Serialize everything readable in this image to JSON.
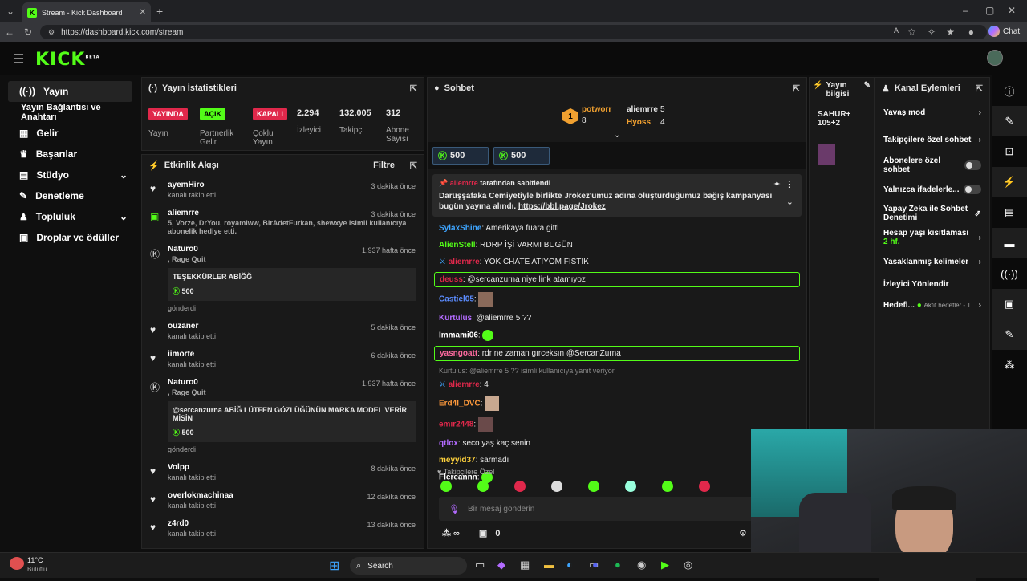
{
  "browser": {
    "tab_title": "Stream - Kick Dashboard",
    "url": "https://dashboard.kick.com/stream",
    "chat_label": "Chat"
  },
  "header": {
    "logo": "KICK",
    "logo_sup": "BETA"
  },
  "sidebar": {
    "items": [
      {
        "label": "Yayın",
        "icon": "broadcast-icon"
      },
      {
        "label": "Yayın Bağlantısı ve Anahtarı",
        "icon": ""
      },
      {
        "label": "Gelir",
        "icon": "chart-icon"
      },
      {
        "label": "Başarılar",
        "icon": "trophy-icon"
      },
      {
        "label": "Stüdyo",
        "icon": "grid-icon"
      },
      {
        "label": "Denetleme",
        "icon": "wrench-icon"
      },
      {
        "label": "Topluluk",
        "icon": "people-icon"
      },
      {
        "label": "Droplar ve ödüller",
        "icon": "gift-icon"
      }
    ]
  },
  "stats": {
    "title": "Yayın İstatistikleri",
    "yayin_badge": "YAYINDA",
    "yayin_label": "Yayın",
    "partner_badge": "AÇIK",
    "partner_label": "Partnerlik Gelir",
    "mode_badge": "KAPALI",
    "mode_label": "Çoklu Yayın",
    "viewers": "2.294",
    "viewers_label": "İzleyici",
    "followers": "132.005",
    "followers_label": "Takipçi",
    "subs": "312",
    "subs_label": "Abone Sayısı"
  },
  "activity": {
    "title": "Etkinlik Akışı",
    "filter": "Filtre",
    "items": [
      {
        "name": "ayemHiro",
        "sub": "kanalı takip etti",
        "time": "3 dakika önce",
        "icon": "heart-icon"
      },
      {
        "name": "aliemrre",
        "sub": "5, Vorze, DrYou, royamiww, BirAdetFurkan, shewxye isimli kullanıcıya abonelik hediye etti.",
        "time": "3 dakika önce",
        "icon": "gift-icon"
      },
      {
        "name": "Naturo0",
        "sub": ", Rage Quit",
        "time": "1.937 hafta önce",
        "icon": "kick-icon",
        "msg": "TEŞEKKÜRLER ABİĞĞ",
        "amount": "500",
        "sent": "gönderdi"
      },
      {
        "name": "ouzaner",
        "sub": "kanalı takip etti",
        "time": "5 dakika önce",
        "icon": "heart-icon"
      },
      {
        "name": "iimorte",
        "sub": "kanalı takip etti",
        "time": "6 dakika önce",
        "icon": "heart-icon"
      },
      {
        "name": "Naturo0",
        "sub": ", Rage Quit",
        "time": "1.937 hafta önce",
        "icon": "kick-icon",
        "msg": "@sercanzurna ABİĞ LÜTFEN GÖZLÜĞÜNÜN MARKA MODEL VERİR MİSİN",
        "amount": "500",
        "sent": "gönderdi"
      },
      {
        "name": "Volpp",
        "sub": "kanalı takip etti",
        "time": "8 dakika önce",
        "icon": "heart-icon"
      },
      {
        "name": "overlokmachinaa",
        "sub": "kanalı takip etti",
        "time": "12 dakika önce",
        "icon": "heart-icon"
      },
      {
        "name": "z4rd0",
        "sub": "kanalı takip etti",
        "time": "13 dakika önce",
        "icon": "heart-icon"
      }
    ]
  },
  "chat": {
    "title": "Sohbet",
    "top": [
      {
        "rank": "1",
        "name": "potworr",
        "count": "8"
      },
      {
        "name": "aliemrre",
        "count": "5"
      },
      {
        "name": "Hyoss",
        "count": "4"
      }
    ],
    "pills": [
      "500",
      "500"
    ],
    "pinned_by": "tarafından sabitlendi",
    "pinned_user": "aliemrre",
    "pinned_text": "Darüşşafaka Cemiyetiyle birlikte Jrokez'umuz adına oluşturduğumuz bağış kampanyası bugün yayına alındı.",
    "pinned_link": "https://bbl.page/Jrokez",
    "messages": [
      {
        "user": "SylaxShine",
        "color": "#3ea5ff",
        "text": "Amerikaya fuara gitti"
      },
      {
        "user": "AlienStell",
        "color": "#53fc18",
        "text": "RDRP İŞİ VARMI BUGÜN"
      },
      {
        "user": "aliemrre",
        "color": "#e0284b",
        "text": "YOK CHATE ATIYOM FISTIK"
      },
      {
        "user": "deuss",
        "color": "#e0284b",
        "text": "@sercanzurna niye link atamıyoz",
        "hl": true
      },
      {
        "user": "Castiel05",
        "color": "#5b8cff",
        "text": ""
      },
      {
        "user": "Kurtulus",
        "color": "#b36bff",
        "text": "@aliemrre 5 ??"
      },
      {
        "user": "Immami06",
        "color": "#ffffff",
        "text": ""
      },
      {
        "user": "yasngoatt",
        "color": "#ff6aa0",
        "text": "rdr ne zaman gırceksın @SercanZurna",
        "hl": true
      },
      {
        "user": "aliemrre",
        "color": "#e0284b",
        "text": "4",
        "reply": "Kurtulus: @aliemrre 5 ?? isimli kullanıcıya yanıt veriyor"
      },
      {
        "user": "Erd4l_DVC",
        "color": "#ff9a3c",
        "text": ""
      },
      {
        "user": "emir2448",
        "color": "#e0284b",
        "text": ""
      },
      {
        "user": "qtlox",
        "color": "#b36bff",
        "text": "seco yaş kaç senin"
      },
      {
        "user": "meyyid37",
        "color": "#ffd23c",
        "text": "sarmadı"
      },
      {
        "user": "Flereannn",
        "color": "#ffffff",
        "text": ""
      }
    ],
    "emote_label": "Takipçilere Özel",
    "input_placeholder": "Bir mesaj gönderin",
    "points": "0"
  },
  "stream_info": {
    "title": "Yayın bilgisi",
    "text": "SAHUR+ 105+2"
  },
  "actions": {
    "title": "Kanal Eylemleri",
    "items": [
      {
        "label": "Yavaş mod",
        "type": "arrow"
      },
      {
        "label": "Takipçilere özel sohbet",
        "type": "arrow"
      },
      {
        "label": "Abonelere özel sohbet",
        "type": "toggle"
      },
      {
        "label": "Yalnızca ifadelerle...",
        "type": "toggle"
      },
      {
        "label": "Yapay Zeka ile Sohbet Denetimi",
        "type": "ext"
      },
      {
        "label": "Hesap yaşı kısıtlaması",
        "type": "arrow",
        "sub": "2 hf."
      },
      {
        "label": "Yasaklanmış kelimeler",
        "type": "arrow"
      },
      {
        "label": "İzleyici Yönlendir",
        "type": "none"
      },
      {
        "label": "Hedefl...",
        "type": "arrow",
        "sub": "Aktif hedefler - 1"
      }
    ]
  },
  "taskbar": {
    "temp": "11°C",
    "weather": "Bulutlu",
    "search": "Search"
  }
}
